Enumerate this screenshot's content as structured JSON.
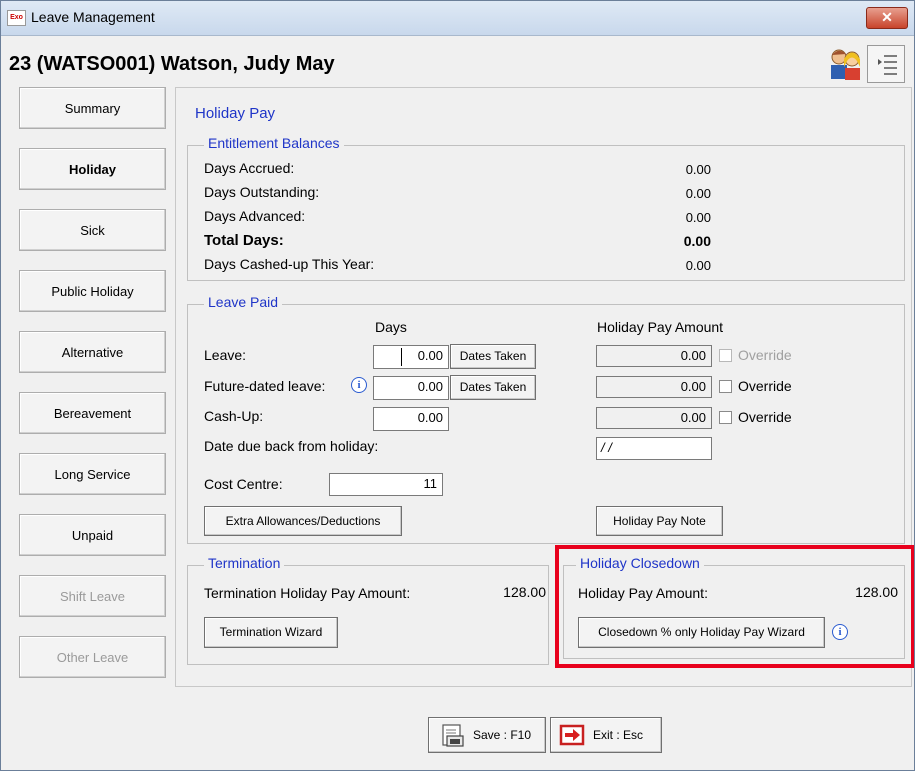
{
  "window": {
    "title": "Leave Management",
    "app_icon_text": "Exo",
    "close_symbol": "✕"
  },
  "employee_header": "23 (WATSO001) Watson, Judy May",
  "nav": {
    "summary": "Summary",
    "holiday": "Holiday",
    "sick": "Sick",
    "public_holiday": "Public Holiday",
    "alternative": "Alternative",
    "bereavement": "Bereavement",
    "long_service": "Long Service",
    "unpaid": "Unpaid",
    "shift_leave": "Shift Leave",
    "other_leave": "Other Leave"
  },
  "panel_title": "Holiday Pay",
  "entitlement": {
    "legend": "Entitlement Balances",
    "rows": [
      {
        "label": "Days Accrued:",
        "value": "0.00"
      },
      {
        "label": "Days Outstanding:",
        "value": "0.00"
      },
      {
        "label": "Days Advanced:",
        "value": "0.00"
      },
      {
        "label": "Total Days:",
        "value": "0.00"
      },
      {
        "label": "Days Cashed-up This Year:",
        "value": "0.00"
      }
    ]
  },
  "leave_paid": {
    "legend": "Leave Paid",
    "days_header": "Days",
    "amount_header": "Holiday Pay Amount",
    "leave_label": "Leave:",
    "leave_days": "0.00",
    "future_label": "Future-dated leave:",
    "future_days": "0.00",
    "cashup_label": "Cash-Up:",
    "cashup_days": "0.00",
    "dates_taken": "Dates Taken",
    "leave_amount": "0.00",
    "future_amount": "0.00",
    "cashup_amount": "0.00",
    "override": "Override",
    "date_due_label": "Date due back from holiday:",
    "date_due_value": "/ /",
    "cost_centre_label": "Cost Centre:",
    "cost_centre_value": "11",
    "extra_btn": "Extra Allowances/Deductions",
    "note_btn": "Holiday Pay Note"
  },
  "termination": {
    "legend": "Termination",
    "label": "Termination Holiday Pay Amount:",
    "value": "128.00",
    "wizard_btn": "Termination Wizard"
  },
  "closedown": {
    "legend": "Holiday Closedown",
    "label": "Holiday Pay Amount:",
    "value": "128.00",
    "wizard_btn": "Closedown % only Holiday Pay Wizard"
  },
  "bottom": {
    "save": "Save : F10",
    "exit": "Exit : Esc"
  },
  "info_glyph": "i",
  "colors": {
    "accent_blue": "#1f35c8",
    "highlight_red": "#e8001c"
  }
}
